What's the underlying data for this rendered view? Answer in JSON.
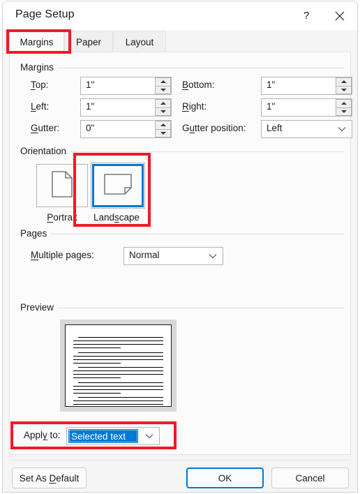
{
  "window": {
    "title": "Page Setup",
    "help_icon": "question-mark-icon",
    "close_icon": "close-icon"
  },
  "tabs": [
    {
      "label": "Margins",
      "active": true
    },
    {
      "label": "Paper",
      "active": false
    },
    {
      "label": "Layout",
      "active": false
    }
  ],
  "margins": {
    "group_label": "Margins",
    "top": {
      "label_pre": "T",
      "label_post": "op:",
      "value": "1\""
    },
    "left": {
      "label_pre": "L",
      "label_post": "eft:",
      "value": "1\""
    },
    "gutter": {
      "label_pre": "G",
      "label_post": "utter:",
      "value": "0\""
    },
    "bottom": {
      "label_pre": "B",
      "label_post": "ottom:",
      "value": "1\""
    },
    "right": {
      "label_pre": "R",
      "label_post": "ight:",
      "value": "1\""
    },
    "gutter_position": {
      "label_a": "G",
      "label_b": "u",
      "label_c": "tter position:",
      "value": "Left"
    }
  },
  "orientation": {
    "group_label": "Orientation",
    "portrait": {
      "label_pre": "P",
      "label_post": "ortrait",
      "selected": false,
      "icon": "portrait-page-icon"
    },
    "landscape": {
      "label_a": "Land",
      "label_b": "s",
      "label_c": "cape",
      "selected": true,
      "icon": "landscape-page-icon"
    }
  },
  "pages": {
    "group_label": "Pages",
    "multiple_pages": {
      "label_pre": "M",
      "label_post": "ultiple pages:",
      "value": "Normal"
    }
  },
  "preview": {
    "group_label": "Preview",
    "page_orientation": "landscape",
    "paragraph_blocks": 5,
    "lines_per_block": 4
  },
  "apply_to": {
    "label_a": "Appl",
    "label_b": "y",
    "label_c": " to:",
    "value": "Selected text",
    "highlighted": true
  },
  "footer": {
    "set_as_default": {
      "pre": "Set As ",
      "key": "D",
      "post": "efault"
    },
    "ok": "OK",
    "cancel": "Cancel"
  },
  "annotations": {
    "color": "#ee1b24",
    "targets": [
      "tab-margins",
      "orientation-landscape",
      "apply-to-row"
    ]
  },
  "colors": {
    "accent": "#0078d4",
    "annotation": "#ee1b24",
    "dialog_bg": "#f5f5f5",
    "panel_bg": "#fbfbfb",
    "titlebar_bg": "#ffffff",
    "text": "#1b1b1b"
  }
}
